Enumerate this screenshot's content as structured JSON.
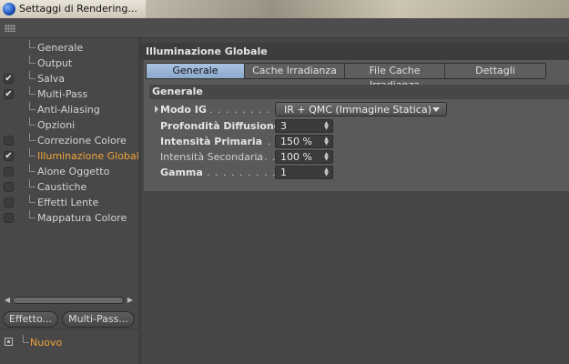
{
  "window": {
    "title": "Settaggi di Rendering..."
  },
  "sidebar": {
    "items": [
      {
        "label": "Generale",
        "checkbox": false,
        "checked": false,
        "active": false
      },
      {
        "label": "Output",
        "checkbox": false,
        "checked": false,
        "active": false
      },
      {
        "label": "Salva",
        "checkbox": true,
        "checked": true,
        "active": false
      },
      {
        "label": "Multi-Pass",
        "checkbox": true,
        "checked": true,
        "active": false
      },
      {
        "label": "Anti-Aliasing",
        "checkbox": false,
        "checked": false,
        "active": false
      },
      {
        "label": "Opzioni",
        "checkbox": false,
        "checked": false,
        "active": false
      },
      {
        "label": "Correzione Colore",
        "checkbox": true,
        "checked": false,
        "active": false
      },
      {
        "label": "Illuminazione Globale",
        "checkbox": true,
        "checked": true,
        "active": true
      },
      {
        "label": "Alone Oggetto",
        "checkbox": true,
        "checked": false,
        "active": false
      },
      {
        "label": "Caustiche",
        "checkbox": true,
        "checked": false,
        "active": false
      },
      {
        "label": "Effetti Lente",
        "checkbox": true,
        "checked": false,
        "active": false
      },
      {
        "label": "Mappatura Colore",
        "checkbox": true,
        "checked": false,
        "active": false
      }
    ],
    "effect_button": "Effetto...",
    "multipass_button": "Multi-Pass...",
    "new_item": "Nuovo"
  },
  "panel": {
    "title": "Illuminazione Globale",
    "tabs": [
      "Generale",
      "Cache Irradianza",
      "File Cache Irradianza",
      "Dettagli"
    ],
    "selected_tab": "Generale",
    "group_title": "Generale",
    "fields": {
      "mode": {
        "label": "Modo IG",
        "dots": " . . . . . . . . . . . .",
        "value": "IR + QMC (Immagine Statica)"
      },
      "depth": {
        "label": "Profondità Diffusione",
        "dots": "",
        "value": "3"
      },
      "primary": {
        "label": "Intensità Primaria",
        "dots": " . . .",
        "value": "150 %"
      },
      "secondary": {
        "label": "Intensità Secondaria",
        "dots": " . . .",
        "value": "100 %"
      },
      "gamma": {
        "label": "Gamma",
        "dots": " . . . . . . . . . . . . . .",
        "value": "1"
      }
    }
  },
  "colors": {
    "accent_active": "#f2a33a",
    "tab_selected": "#8ca8cc",
    "background": "#484848"
  }
}
